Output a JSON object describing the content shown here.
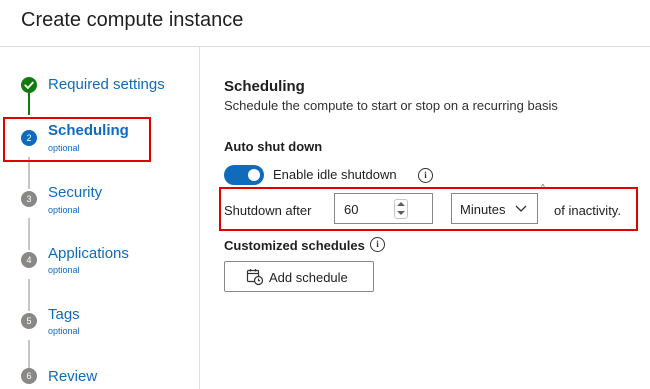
{
  "window": {
    "title": "Create compute instance"
  },
  "steps": [
    {
      "number": "",
      "label": "Required settings",
      "sub": "",
      "state": "done"
    },
    {
      "number": "2",
      "label": "Scheduling",
      "sub": "optional",
      "state": "current"
    },
    {
      "number": "3",
      "label": "Security",
      "sub": "optional",
      "state": "future"
    },
    {
      "number": "4",
      "label": "Applications",
      "sub": "optional",
      "state": "future"
    },
    {
      "number": "5",
      "label": "Tags",
      "sub": "optional",
      "state": "future"
    },
    {
      "number": "6",
      "label": "Review",
      "sub": "",
      "state": "future"
    }
  ],
  "scheduling": {
    "title": "Scheduling",
    "description": "Schedule the compute to start or stop on a recurring basis",
    "auto_shutdown_label": "Auto shut down",
    "idle_toggle": {
      "label": "Enable idle shutdown",
      "on": true
    },
    "shutdown_prefix": "Shutdown after",
    "shutdown_value": "60",
    "unit_selected": "Minutes",
    "shutdown_suffix": "of inactivity.",
    "custom_label": "Customized schedules",
    "add_schedule_label": "Add schedule"
  },
  "icons": {
    "step_done": "check-icon",
    "info": "info-icon",
    "unit_dropdown": "chevron-down-icon",
    "add_schedule": "calendar-clock-icon"
  },
  "colors": {
    "accent": "#0f6cbd",
    "success": "#107c10",
    "highlight": "#e00000",
    "future_step": "#8a8886"
  }
}
